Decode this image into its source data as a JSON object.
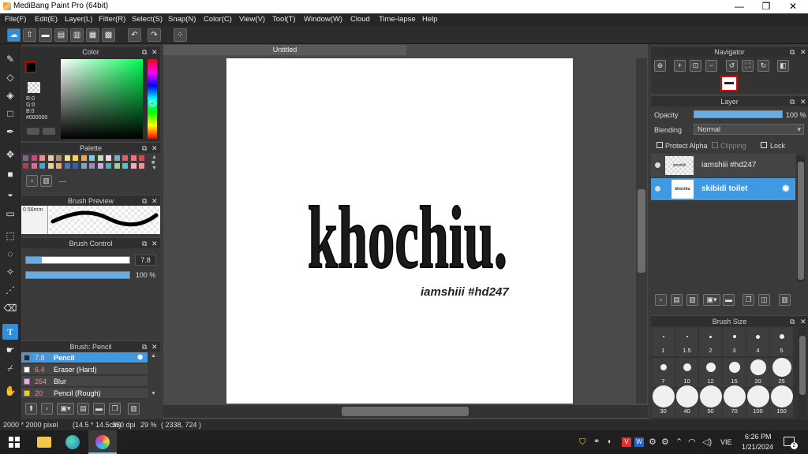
{
  "window": {
    "title": "MediBang Paint Pro (64bit)",
    "minimize": "—",
    "restore": "❐",
    "close": "✕"
  },
  "menu": [
    "File(F)",
    "Edit(E)",
    "Layer(L)",
    "Filter(R)",
    "Select(S)",
    "Snap(N)",
    "Color(C)",
    "View(V)",
    "Tool(T)",
    "Window(W)",
    "Cloud",
    "Time-lapse",
    "Help"
  ],
  "color_panel": {
    "title": "Color",
    "r": "R:0",
    "g": "G:0",
    "b": "B:0",
    "hex": "#000000"
  },
  "palette_panel": {
    "title": "Palette",
    "trailing": "---",
    "swatches": [
      "#8b5a9b",
      "#c14a7a",
      "#f08c8c",
      "#f7c59f",
      "#b58e64",
      "#f2e394",
      "#f9d84c",
      "#f9a342",
      "#7ecbf2",
      "#b6e3b1",
      "#f5d7e3",
      "#7aa6d8",
      "#e26060",
      "#f57373",
      "#d94848",
      "#ba3a4a",
      "#e56b8a",
      "#4fa0d0",
      "#f0d088",
      "#f4a85d",
      "#4a79b5",
      "#3f5fa0",
      "#6fa9d6",
      "#9f87c5",
      "#c9a7e2",
      "#4fb4a8",
      "#9ed48a",
      "#57c4c4",
      "#f7a8c4",
      "#f88f8f"
    ]
  },
  "brush_preview_panel": {
    "title": "Brush Preview",
    "size": "0.56mm"
  },
  "brush_control_panel": {
    "title": "Brush Control",
    "size_value": "7.8",
    "opacity_value": "100 %",
    "size_fraction": 0.15,
    "opacity_fraction": 1.0
  },
  "brush_list_panel": {
    "title": "Brush: Pencil",
    "items": [
      {
        "size": "7.8",
        "name": "Pencil",
        "color": "#2a2a2a",
        "selected": true
      },
      {
        "size": "6.4",
        "name": "Eraser (Hard)",
        "color": "#ffffff",
        "selected": false
      },
      {
        "size": "264",
        "name": "Blur",
        "color": "#f4a8e8",
        "selected": false
      },
      {
        "size": "20",
        "name": "Pencil (Rough)",
        "color": "#f2d400",
        "selected": false
      }
    ]
  },
  "document": {
    "tab": "Untitled",
    "artwork_title": "khochiu.",
    "signature": "iamshiii #hd247"
  },
  "navigator_panel": {
    "title": "Navigator"
  },
  "layer_panel": {
    "title": "Layer",
    "opacity_label": "Opacity",
    "opacity_value": "100 %",
    "blending_label": "Blending",
    "blending_value": "Normal",
    "protect_alpha": "Protect Alpha",
    "clipping": "Clipping",
    "lock": "Lock",
    "layers": [
      {
        "name": "iamshiii #hd247",
        "thumb": "iamshiii",
        "selected": false
      },
      {
        "name": "skibidi toilet",
        "thumb": "khochiu",
        "selected": true
      }
    ]
  },
  "brush_size_panel": {
    "title": "Brush Size",
    "sizes": [
      "1",
      "1.5",
      "2",
      "3",
      "4",
      "5",
      "7",
      "10",
      "12",
      "15",
      "20",
      "25",
      "30",
      "40",
      "50",
      "70",
      "100",
      "150"
    ]
  },
  "status": {
    "canvas_size": "2000 * 2000 pixel",
    "physical": "(14.5 * 14.5cm)",
    "dpi": "350 dpi",
    "zoom": "29 %",
    "cursor": "( 2338, 724 )"
  },
  "taskbar": {
    "time": "6:26 PM",
    "date": "1/21/2024",
    "lang": "VIE"
  }
}
